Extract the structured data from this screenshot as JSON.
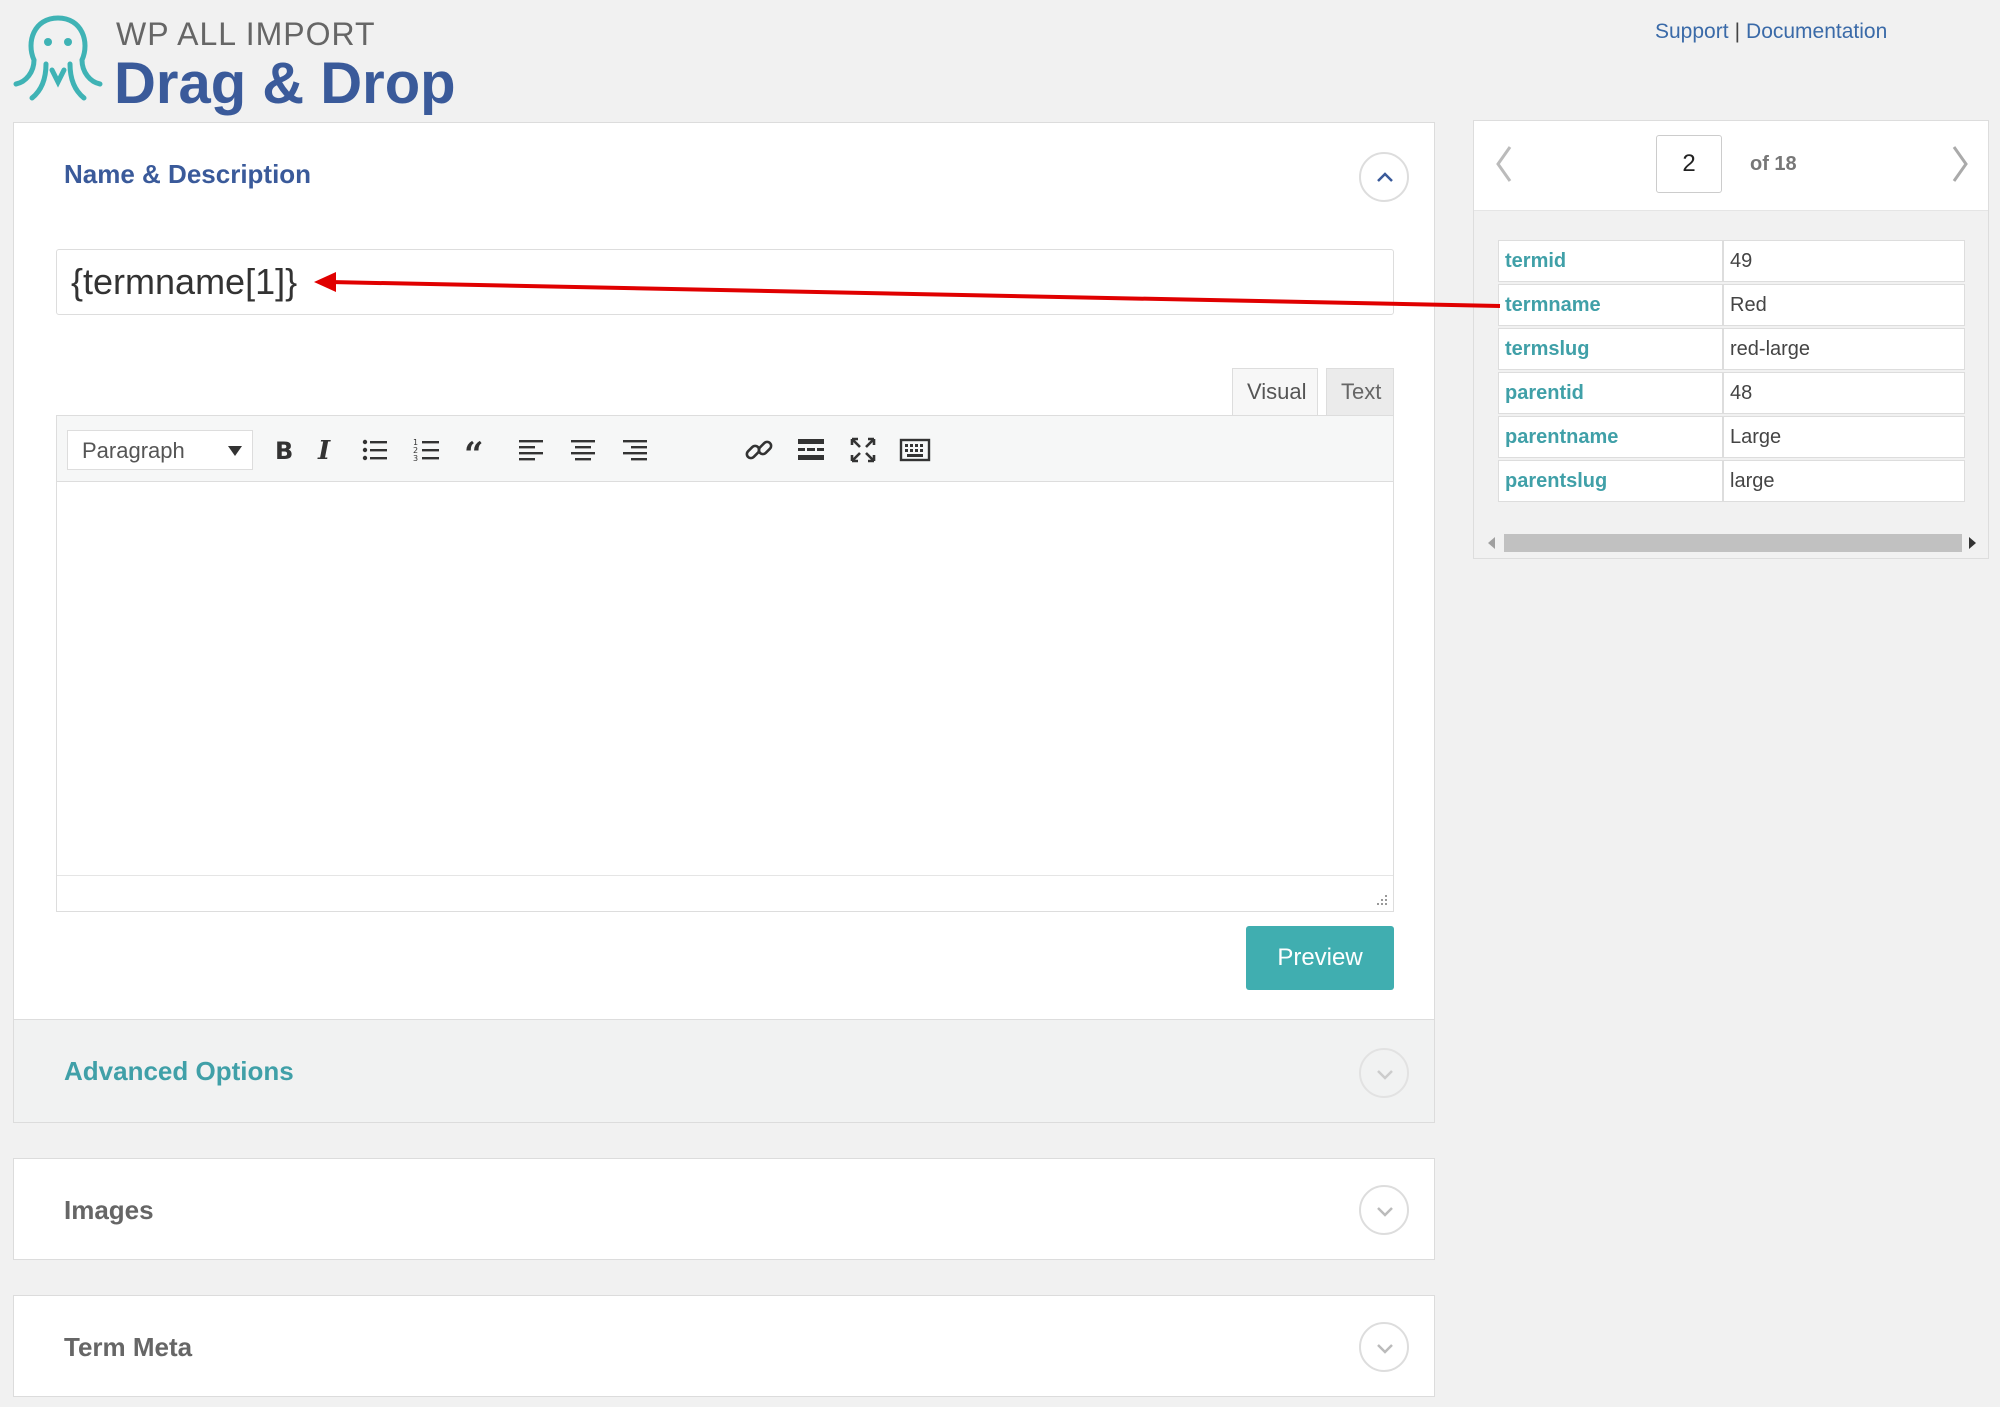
{
  "header": {
    "brand_small": "WP ALL IMPORT",
    "brand_big": "Drag & Drop",
    "support_link": "Support",
    "separator": "|",
    "documentation_link": "Documentation"
  },
  "name_description": {
    "title": "Name & Description",
    "name_value": "{termname[1]}",
    "tabs": {
      "visual": "Visual",
      "text": "Text"
    },
    "format_select": "Paragraph",
    "toolbar_icons": [
      "bold-icon",
      "italic-icon",
      "bullet-list-icon",
      "numbered-list-icon",
      "blockquote-icon",
      "align-left-icon",
      "align-center-icon",
      "align-right-icon",
      "link-icon",
      "read-more-icon",
      "fullscreen-icon",
      "toolbar-toggle-icon"
    ],
    "preview_button": "Preview"
  },
  "sections": {
    "advanced": "Advanced Options",
    "images": "Images",
    "term_meta": "Term Meta"
  },
  "record_viewer": {
    "current_page": "2",
    "of_label": "of 18",
    "rows": [
      {
        "key": "termid",
        "value": "49"
      },
      {
        "key": "termname",
        "value": "Red"
      },
      {
        "key": "termslug",
        "value": "red-large"
      },
      {
        "key": "parentid",
        "value": "48"
      },
      {
        "key": "parentname",
        "value": "Large"
      },
      {
        "key": "parentslug",
        "value": "large"
      }
    ]
  },
  "colors": {
    "brand_blue": "#3a5a9a",
    "teal": "#40aeb0",
    "annotation_arrow": "#e00000"
  }
}
